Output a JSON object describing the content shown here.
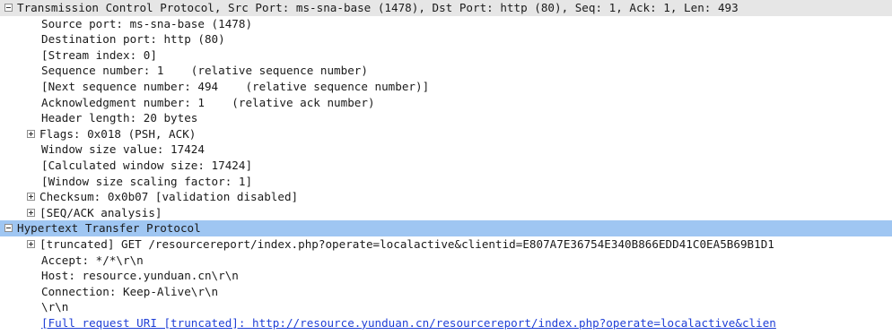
{
  "tree": {
    "rows": [
      {
        "text": "Transmission Control Protocol, Src Port: ms-sna-base (1478), Dst Port: http (80), Seq: 1, Ack: 1, Len: 493",
        "level": 0,
        "toggle": "minus",
        "highlight": "gray"
      },
      {
        "text": "Source port: ms-sna-base (1478)",
        "level": 1
      },
      {
        "text": "Destination port: http (80)",
        "level": 1
      },
      {
        "text": "[Stream index: 0]",
        "level": 1
      },
      {
        "text": "Sequence number: 1    (relative sequence number)",
        "level": 1
      },
      {
        "text": "[Next sequence number: 494    (relative sequence number)]",
        "level": 1
      },
      {
        "text": "Acknowledgment number: 1    (relative ack number)",
        "level": 1
      },
      {
        "text": "Header length: 20 bytes",
        "level": 1
      },
      {
        "text": "Flags: 0x018 (PSH, ACK)",
        "level": 1,
        "toggle": "plus"
      },
      {
        "text": "Window size value: 17424",
        "level": 1
      },
      {
        "text": "[Calculated window size: 17424]",
        "level": 1
      },
      {
        "text": "[Window size scaling factor: 1]",
        "level": 1
      },
      {
        "text": "Checksum: 0x0b07 [validation disabled]",
        "level": 1,
        "toggle": "plus"
      },
      {
        "text": "[SEQ/ACK analysis]",
        "level": 1,
        "toggle": "plus"
      },
      {
        "text": "Hypertext Transfer Protocol",
        "level": 0,
        "toggle": "minus",
        "highlight": "blue"
      },
      {
        "text": "[truncated] GET /resourcereport/index.php?operate=localactive&clientid=E807A7E36754E340B866EDD41C0EA5B69B1D1",
        "level": 1,
        "toggle": "plus"
      },
      {
        "text": "Accept: */*\\r\\n",
        "level": 1
      },
      {
        "text": "Host: resource.yunduan.cn\\r\\n",
        "level": 1
      },
      {
        "text": "Connection: Keep-Alive\\r\\n",
        "level": 1
      },
      {
        "text": "\\r\\n",
        "level": 1
      },
      {
        "text": "[Full request URI [truncated]: http://resource.yunduan.cn/resourcereport/index.php?operate=localactive&clien",
        "level": 1,
        "link": true
      }
    ]
  },
  "colors": {
    "gray_highlight": "#e6e6e6",
    "blue_highlight": "#9fc6f2",
    "link": "#1f3fd6"
  },
  "icons": {
    "expanded": "tree-collapse-icon",
    "collapsed": "tree-expand-icon"
  }
}
